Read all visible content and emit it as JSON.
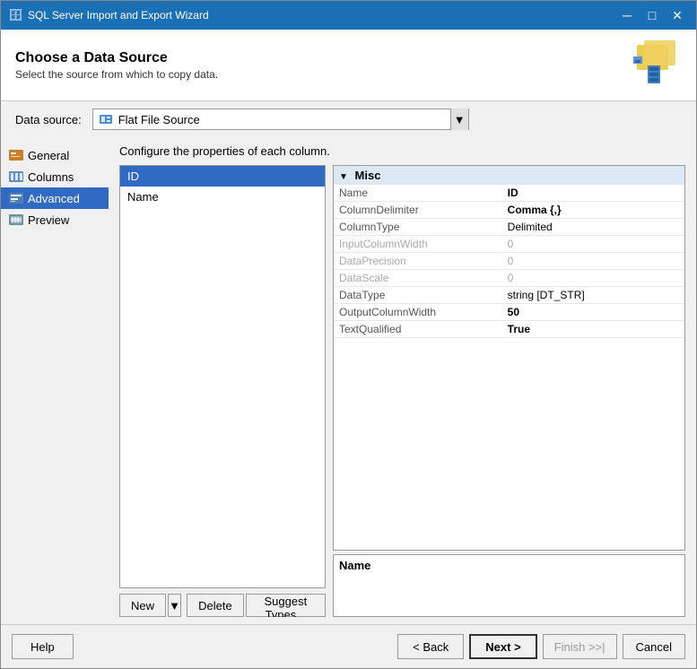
{
  "titleBar": {
    "icon": "🗄",
    "title": "SQL Server Import and Export Wizard",
    "minimizeLabel": "─",
    "maximizeLabel": "□",
    "closeLabel": "✕"
  },
  "header": {
    "title": "Choose a Data Source",
    "subtitle": "Select the source from which to copy data."
  },
  "dataSource": {
    "label": "Data source:",
    "value": "Flat File Source",
    "dropdownArrow": "▼"
  },
  "configureLabel": "Configure the properties of each column.",
  "sidebar": {
    "items": [
      {
        "id": "general",
        "label": "General",
        "active": false
      },
      {
        "id": "columns",
        "label": "Columns",
        "active": false
      },
      {
        "id": "advanced",
        "label": "Advanced",
        "active": true
      },
      {
        "id": "preview",
        "label": "Preview",
        "active": false
      }
    ]
  },
  "columns": [
    {
      "name": "ID",
      "selected": true
    },
    {
      "name": "Name",
      "selected": false
    }
  ],
  "properties": {
    "sectionLabel": "Misc",
    "rows": [
      {
        "property": "Name",
        "value": "ID",
        "bold": true
      },
      {
        "property": "ColumnDelimiter",
        "value": "Comma {,}",
        "bold": true
      },
      {
        "property": "ColumnType",
        "value": "Delimited",
        "bold": false
      },
      {
        "property": "InputColumnWidth",
        "value": "0",
        "bold": false,
        "disabled": true
      },
      {
        "property": "DataPrecision",
        "value": "0",
        "bold": false,
        "disabled": true
      },
      {
        "property": "DataScale",
        "value": "0",
        "bold": false,
        "disabled": true
      },
      {
        "property": "DataType",
        "value": "string [DT_STR]",
        "bold": false
      },
      {
        "property": "OutputColumnWidth",
        "value": "50",
        "bold": true
      },
      {
        "property": "TextQualified",
        "value": "True",
        "bold": true
      }
    ]
  },
  "nameBox": {
    "label": "Name"
  },
  "actions": {
    "newLabel": "New",
    "deleteLabel": "Delete",
    "suggestTypesLabel": "Suggest Types..."
  },
  "footer": {
    "helpLabel": "Help",
    "backLabel": "< Back",
    "nextLabel": "Next >",
    "finishLabel": "Finish >>|",
    "cancelLabel": "Cancel"
  }
}
